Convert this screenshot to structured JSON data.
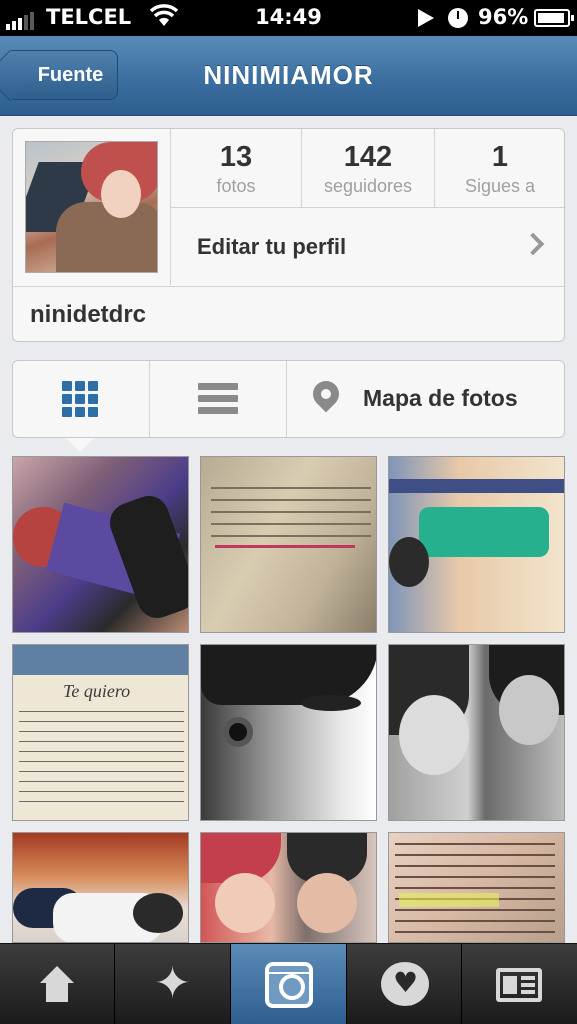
{
  "status_bar": {
    "carrier": "TELCEL",
    "time": "14:49",
    "battery": "96%",
    "icons": [
      "signal-icon",
      "wifi-icon",
      "play-icon",
      "alarm-clock-icon",
      "battery-icon"
    ]
  },
  "nav": {
    "back_label": "Fuente",
    "title": "NINIMIAMOR"
  },
  "profile": {
    "username": "ninidetdrc",
    "stats": [
      {
        "count": "13",
        "label": "fotos"
      },
      {
        "count": "142",
        "label": "seguidores"
      },
      {
        "count": "1",
        "label": "Sigues a"
      }
    ],
    "edit_label": "Editar tu perfil"
  },
  "view_toggle": {
    "active": "grid",
    "map_label": "Mapa de fotos",
    "icons": [
      "grid-icon",
      "list-icon",
      "map-pin-icon"
    ]
  },
  "photos": [
    {
      "name": "photo-mirror-selfie"
    },
    {
      "name": "photo-book-page"
    },
    {
      "name": "photo-rotated-portrait"
    },
    {
      "name": "photo-handwritten-note",
      "text": "Te quiero"
    },
    {
      "name": "photo-bw-closeup"
    },
    {
      "name": "photo-two-girls-bw"
    },
    {
      "name": "photo-lying-girl"
    },
    {
      "name": "photo-two-friends"
    },
    {
      "name": "photo-book-text"
    }
  ],
  "tab_bar": {
    "active": "camera",
    "tabs": [
      "home-icon",
      "explore-star-icon",
      "camera-icon",
      "news-heart-icon",
      "profile-icon"
    ]
  },
  "colors": {
    "nav_blue": "#3b6f9f",
    "accent_blue": "#2f6fa8",
    "background": "#e9ebee"
  }
}
